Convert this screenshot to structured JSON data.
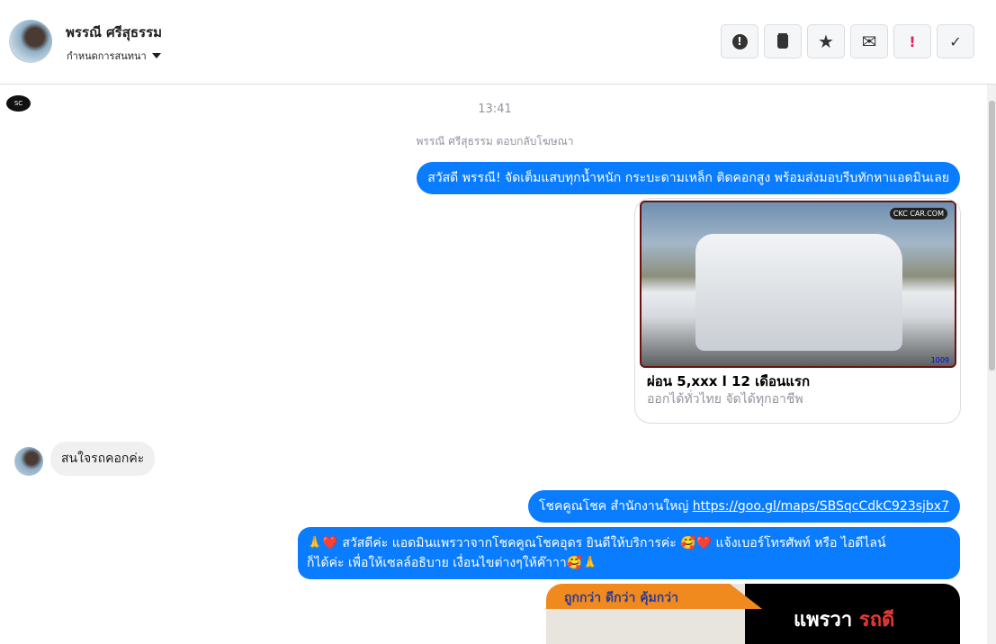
{
  "header": {
    "contact_name": "พรรณี ศรีสุธรรม",
    "assign_label": "กำหนดการสนทนา"
  },
  "actions": [
    {
      "icon": "alert-octagon-icon",
      "symbol": "!"
    },
    {
      "icon": "trash-icon",
      "symbol": "🗑"
    },
    {
      "icon": "star-icon",
      "symbol": "★"
    },
    {
      "icon": "envelope-icon",
      "symbol": "✉"
    },
    {
      "icon": "exclamation-icon",
      "symbol": "!"
    },
    {
      "icon": "check-icon",
      "symbol": "✓"
    }
  ],
  "chat": {
    "time": "13:41",
    "system_note": "พรรณี ศรีสุธรรม ตอบกลับโฆษณา",
    "msg1": "สวัสดี พรรณี! จัดเต็มแสบทุกน้ำหนัก กระบะดามเหล็ก ติดคอกสูง พร้อมส่งมอบรีบทักหาแอดมินเลย",
    "card": {
      "title": "ผ่อน 5,xxx l 12 เดือนแรก",
      "subtitle": "ออกได้ทั่วไทย จัดได้ทุกอาชีพ",
      "logo_text": "CKC CAR.COM",
      "plate_text": "1009"
    },
    "incoming": "สนใจรถคอกค่ะ",
    "msg2_text": "โชคคูณโชค สำนักงานใหญ่ ",
    "msg2_link": "https://goo.gl/maps/SBSqcCdkC923sjbx7",
    "msg3_line1": "🙏❤️ สวัสดีค่ะ แอดมินแพรวาจากโชคคูณโชคอุดร ยินดีให้บริการค่ะ  🥰❤️ แจ้งเบอร์โทรศัพท์ หรือ ไอดีไลน์",
    "msg3_line2": "ก็ได้ค่ะ เพื่อให้เซลล์อธิบาย เงื่อนไขต่างๆให้ค๊าาา🥰🙏",
    "banner": {
      "slogan": "ถูกกว่า ดีกว่า คุ้มกว่า",
      "brand_a": "แพรวา ",
      "brand_b": "รถดี"
    },
    "page_logo": "SC"
  },
  "colors": {
    "accent": "#0a7cff",
    "bubble_in": "#f0f0f0"
  }
}
